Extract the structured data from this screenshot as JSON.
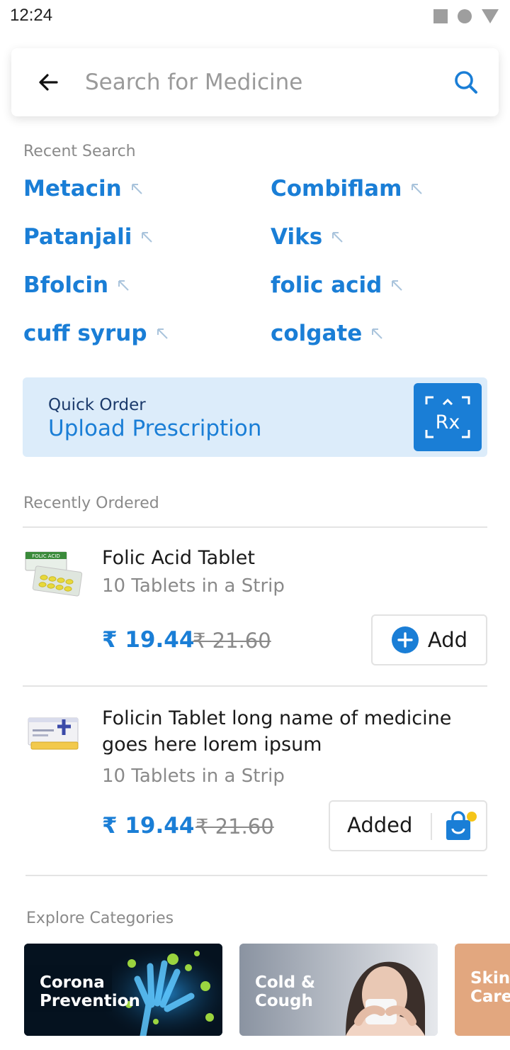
{
  "status_bar": {
    "time": "12:24"
  },
  "search": {
    "placeholder": "Search for Medicine",
    "value": ""
  },
  "recent": {
    "title": "Recent Search",
    "items": [
      {
        "label": "Metacin"
      },
      {
        "label": "Combiflam"
      },
      {
        "label": "Patanjali"
      },
      {
        "label": "Viks"
      },
      {
        "label": "Bfolcin"
      },
      {
        "label": "folic acid"
      },
      {
        "label": "cuff syrup"
      },
      {
        "label": "colgate"
      }
    ]
  },
  "quick_order": {
    "title": "Quick Order",
    "subtitle": "Upload Prescription",
    "rx_label": "Rx"
  },
  "recently_ordered": {
    "title": "Recently Ordered",
    "products": [
      {
        "thumb_label": "FOLIC ACID",
        "name": "Folic Acid Tablet",
        "pack": "10 Tablets in a Strip",
        "price": "₹ 19.44",
        "mrp": "₹ 21.60",
        "action_label": "Add",
        "state": "add"
      },
      {
        "name_line1": "Folicin Tablet long name of medicine",
        "name_line2": "goes here lorem ipsum",
        "pack": "10 Tablets in a Strip",
        "price": "₹ 19.44",
        "mrp": "₹ 21.60",
        "action_label": "Added",
        "state": "added"
      }
    ]
  },
  "categories": {
    "title": "Explore Categories",
    "items": [
      {
        "line1": "Corona",
        "line2": "Prevention"
      },
      {
        "line1": "Cold &",
        "line2": "Cough"
      },
      {
        "line1": "Skin",
        "line2": "Care"
      }
    ]
  },
  "colors": {
    "accent": "#1a7ed6",
    "banner_bg": "#dcecfa",
    "badge": "#f5c518"
  },
  "icons": [
    "back-arrow-icon",
    "search-icon",
    "recent-arrow-icon",
    "rx-scan-icon",
    "plus-circle-icon",
    "shopping-bag-icon"
  ]
}
